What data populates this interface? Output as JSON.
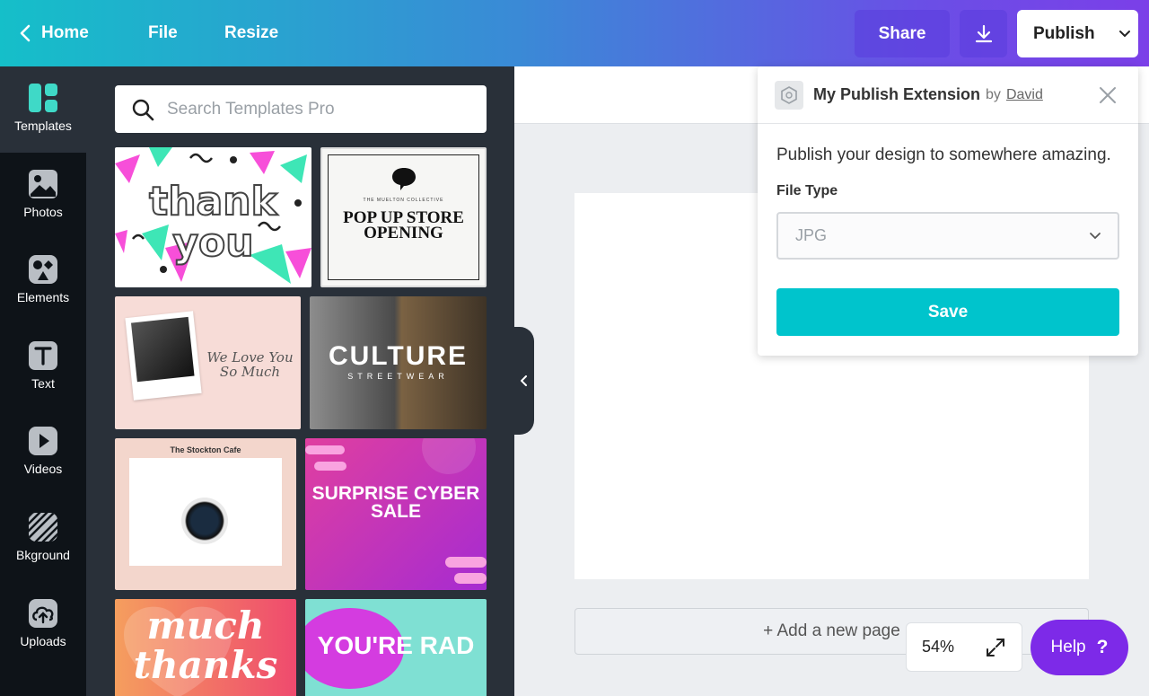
{
  "topbar": {
    "home_label": "Home",
    "file_label": "File",
    "resize_label": "Resize",
    "share_label": "Share",
    "publish_label": "Publish"
  },
  "rail": {
    "items": [
      {
        "label": "Templates",
        "icon": "templates-icon"
      },
      {
        "label": "Photos",
        "icon": "photos-icon"
      },
      {
        "label": "Elements",
        "icon": "elements-icon"
      },
      {
        "label": "Text",
        "icon": "text-icon"
      },
      {
        "label": "Videos",
        "icon": "videos-icon"
      },
      {
        "label": "Bkground",
        "icon": "background-icon"
      },
      {
        "label": "Uploads",
        "icon": "uploads-icon"
      }
    ]
  },
  "panel": {
    "search_placeholder": "Search Templates Pro",
    "templates": [
      {
        "text": "thank you"
      },
      {
        "text": "POP UP STORE OPENING",
        "small": "THE MUELTON COLLECTIVE"
      },
      {
        "text": "We Love You So Much"
      },
      {
        "text": "CULTURE",
        "sub": "STREETWEAR"
      },
      {
        "text": "The Stockton Cafe"
      },
      {
        "text": "SURPRISE CYBER SALE"
      },
      {
        "text": "much thanks"
      },
      {
        "text": "YOU'RE RAD"
      }
    ]
  },
  "editor": {
    "add_page_label": "+ Add a new page",
    "zoom_label": "54%",
    "help_label": "Help",
    "help_glyph": "?"
  },
  "popup": {
    "extension_name": "My Publish Extension",
    "by_label": "by",
    "author": "David",
    "description": "Publish your design to somewhere amazing.",
    "file_type_label": "File Type",
    "file_type_value": "JPG",
    "save_label": "Save"
  },
  "colors": {
    "brand_teal": "#00c4cc",
    "brand_purple": "#7d2ae8",
    "rail_bg": "#0e1318",
    "panel_bg": "#293039"
  }
}
